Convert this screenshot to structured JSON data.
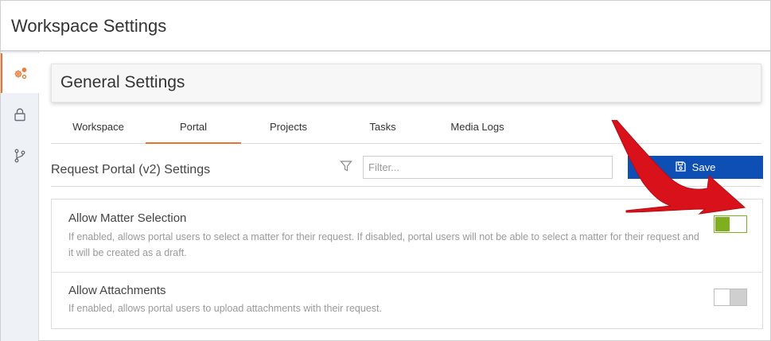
{
  "window": {
    "title": "Workspace Settings"
  },
  "leftnav": {
    "items": [
      {
        "icon": "cogs-icon",
        "active": true
      },
      {
        "icon": "lock-icon",
        "active": false
      },
      {
        "icon": "branch-icon",
        "active": false
      }
    ]
  },
  "card": {
    "title": "General Settings"
  },
  "tabs": [
    {
      "label": "Workspace",
      "active": false
    },
    {
      "label": "Portal",
      "active": true
    },
    {
      "label": "Projects",
      "active": false
    },
    {
      "label": "Tasks",
      "active": false
    },
    {
      "label": "Media Logs",
      "active": false
    }
  ],
  "section": {
    "title": "Request Portal (v2) Settings"
  },
  "filter": {
    "placeholder": "Filter...",
    "value": ""
  },
  "toolbar": {
    "save_label": "Save"
  },
  "settings": [
    {
      "title": "Allow Matter Selection",
      "description": "If enabled, allows portal users to select a matter for their request. If disabled, portal users will not be able to select a matter for their request and it will be created as a draft.",
      "enabled": true
    },
    {
      "title": "Allow Attachments",
      "description": "If enabled, allows portal users to upload attachments with their request.",
      "enabled": false
    }
  ],
  "colors": {
    "accent": "#e8752f",
    "primary_button": "#0d4fb4",
    "toggle_on": "#7db01c",
    "annotation_arrow": "#d9111b"
  }
}
